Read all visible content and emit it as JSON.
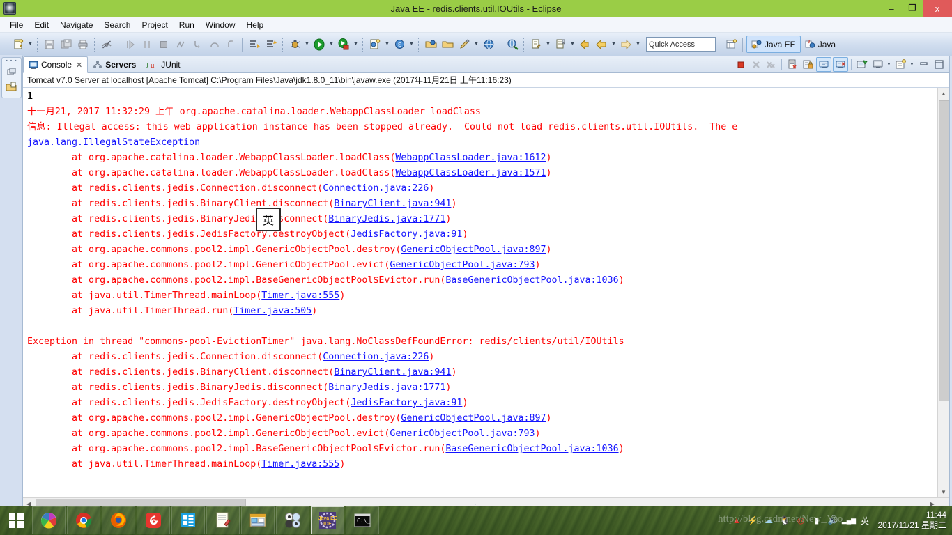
{
  "window": {
    "title": "Java EE - redis.clients.util.IOUtils - Eclipse",
    "app_icon": "eclipse-icon",
    "minimize_label": "–",
    "maximize_label": "❐",
    "close_label": "x",
    "titlebar_color": "#9ACD46"
  },
  "menubar": {
    "items": [
      {
        "label": "File"
      },
      {
        "label": "Edit"
      },
      {
        "label": "Navigate"
      },
      {
        "label": "Search"
      },
      {
        "label": "Project"
      },
      {
        "label": "Run"
      },
      {
        "label": "Window"
      },
      {
        "label": "Help"
      }
    ]
  },
  "toolbar": {
    "quick_access_placeholder": "Quick Access",
    "quick_access_value": "",
    "perspectives": [
      {
        "label": "Java EE",
        "active": true,
        "icon": "javaee-perspective-icon"
      },
      {
        "label": "Java",
        "active": false,
        "icon": "java-perspective-icon"
      }
    ],
    "open_perspective_icon": "open-perspective-icon"
  },
  "left_rail": {
    "restore_icon": "restore-view-icon",
    "project_explorer_icon": "project-explorer-icon"
  },
  "view": {
    "tabs": [
      {
        "label": "Console",
        "icon": "console-icon",
        "active": true,
        "closable": true
      },
      {
        "label": "Servers",
        "icon": "servers-icon",
        "active": false,
        "bold": true
      },
      {
        "label": "JUnit",
        "icon": "junit-icon",
        "active": false
      }
    ],
    "toolbar_buttons": [
      {
        "name": "terminate-button",
        "icon": "stop-square-icon",
        "enabled": true
      },
      {
        "name": "remove-launch-button",
        "icon": "x-icon",
        "enabled": false
      },
      {
        "name": "remove-all-terminated-button",
        "icon": "xx-icon",
        "enabled": false
      },
      {
        "name": "clear-console-button",
        "icon": "clear-console-icon",
        "enabled": true
      },
      {
        "name": "scroll-lock-button",
        "icon": "scroll-lock-icon",
        "enabled": true
      },
      {
        "name": "show-console-on-output-button",
        "icon": "show-on-output-icon",
        "toggled": true
      },
      {
        "name": "show-console-on-error-button",
        "icon": "show-on-error-icon",
        "toggled": true
      },
      {
        "name": "pin-console-button",
        "icon": "pin-console-icon",
        "enabled": true
      },
      {
        "name": "display-selected-console-button",
        "icon": "display-console-icon",
        "enabled": true
      },
      {
        "name": "open-console-button",
        "icon": "open-console-icon",
        "enabled": true
      },
      {
        "name": "minimize-view-button",
        "icon": "minimize-icon",
        "enabled": true
      },
      {
        "name": "maximize-view-button",
        "icon": "maximize-icon",
        "enabled": true
      }
    ],
    "header": "Tomcat v7.0 Server at localhost [Apache Tomcat] C:\\Program Files\\Java\\jdk1.8.0_11\\bin\\javaw.exe (2017年11月21日 上午11:16:23)"
  },
  "console": {
    "ime_indicator": "英",
    "lines": [
      {
        "segments": [
          {
            "text": "1",
            "style": "blk"
          }
        ]
      },
      {
        "segments": [
          {
            "text": "十一月21, 2017 11:32:29 上午 org.apache.catalina.loader.WebappClassLoader loadClass",
            "style": "err"
          }
        ]
      },
      {
        "segments": [
          {
            "text": "信息: Illegal access: this web application instance has been stopped already.  Could not load redis.clients.util.IOUtils.  The e",
            "style": "err"
          }
        ]
      },
      {
        "segments": [
          {
            "text": "java.lang.IllegalStateException",
            "style": "lnk"
          }
        ]
      },
      {
        "segments": [
          {
            "text": "        at org.apache.catalina.loader.WebappClassLoader.loadClass(",
            "style": "err"
          },
          {
            "text": "WebappClassLoader.java:1612",
            "style": "lnk"
          },
          {
            "text": ")",
            "style": "err"
          }
        ]
      },
      {
        "segments": [
          {
            "text": "        at org.apache.catalina.loader.WebappClassLoader.loadClass(",
            "style": "err"
          },
          {
            "text": "WebappClassLoader.java:1571",
            "style": "lnk"
          },
          {
            "text": ")",
            "style": "err"
          }
        ]
      },
      {
        "segments": [
          {
            "text": "        at redis.clients.jedis.Connection.disconnect(",
            "style": "err"
          },
          {
            "text": "Connection.java:226",
            "style": "lnk"
          },
          {
            "text": ")",
            "style": "err"
          }
        ]
      },
      {
        "segments": [
          {
            "text": "        at redis.clients.jedis.BinaryClient.disconnect(",
            "style": "err"
          },
          {
            "text": "BinaryClient.java:941",
            "style": "lnk"
          },
          {
            "text": ")",
            "style": "err"
          }
        ]
      },
      {
        "segments": [
          {
            "text": "        at redis.clients.jedis.BinaryJedis.disconnect(",
            "style": "err"
          },
          {
            "text": "BinaryJedis.java:1771",
            "style": "lnk"
          },
          {
            "text": ")",
            "style": "err"
          }
        ]
      },
      {
        "segments": [
          {
            "text": "        at redis.clients.jedis.JedisFactory.destroyObject(",
            "style": "err"
          },
          {
            "text": "JedisFactory.java:91",
            "style": "lnk"
          },
          {
            "text": ")",
            "style": "err"
          }
        ]
      },
      {
        "segments": [
          {
            "text": "        at org.apache.commons.pool2.impl.GenericObjectPool.destroy(",
            "style": "err"
          },
          {
            "text": "GenericObjectPool.java:897",
            "style": "lnk"
          },
          {
            "text": ")",
            "style": "err"
          }
        ]
      },
      {
        "segments": [
          {
            "text": "        at org.apache.commons.pool2.impl.GenericObjectPool.evict(",
            "style": "err"
          },
          {
            "text": "GenericObjectPool.java:793",
            "style": "lnk"
          },
          {
            "text": ")",
            "style": "err"
          }
        ]
      },
      {
        "segments": [
          {
            "text": "        at org.apache.commons.pool2.impl.BaseGenericObjectPool$Evictor.run(",
            "style": "err"
          },
          {
            "text": "BaseGenericObjectPool.java:1036",
            "style": "lnk"
          },
          {
            "text": ")",
            "style": "err"
          }
        ]
      },
      {
        "segments": [
          {
            "text": "        at java.util.TimerThread.mainLoop(",
            "style": "err"
          },
          {
            "text": "Timer.java:555",
            "style": "lnk"
          },
          {
            "text": ")",
            "style": "err"
          }
        ]
      },
      {
        "segments": [
          {
            "text": "        at java.util.TimerThread.run(",
            "style": "err"
          },
          {
            "text": "Timer.java:505",
            "style": "lnk"
          },
          {
            "text": ")",
            "style": "err"
          }
        ]
      },
      {
        "segments": [
          {
            "text": "",
            "style": "err"
          }
        ]
      },
      {
        "segments": [
          {
            "text": "Exception in thread \"commons-pool-EvictionTimer\" java.lang.NoClassDefFoundError: redis/clients/util/IOUtils",
            "style": "err"
          }
        ]
      },
      {
        "segments": [
          {
            "text": "        at redis.clients.jedis.Connection.disconnect(",
            "style": "err"
          },
          {
            "text": "Connection.java:226",
            "style": "lnk"
          },
          {
            "text": ")",
            "style": "err"
          }
        ]
      },
      {
        "segments": [
          {
            "text": "        at redis.clients.jedis.BinaryClient.disconnect(",
            "style": "err"
          },
          {
            "text": "BinaryClient.java:941",
            "style": "lnk"
          },
          {
            "text": ")",
            "style": "err"
          }
        ]
      },
      {
        "segments": [
          {
            "text": "        at redis.clients.jedis.BinaryJedis.disconnect(",
            "style": "err"
          },
          {
            "text": "BinaryJedis.java:1771",
            "style": "lnk"
          },
          {
            "text": ")",
            "style": "err"
          }
        ]
      },
      {
        "segments": [
          {
            "text": "        at redis.clients.jedis.JedisFactory.destroyObject(",
            "style": "err"
          },
          {
            "text": "JedisFactory.java:91",
            "style": "lnk"
          },
          {
            "text": ")",
            "style": "err"
          }
        ]
      },
      {
        "segments": [
          {
            "text": "        at org.apache.commons.pool2.impl.GenericObjectPool.destroy(",
            "style": "err"
          },
          {
            "text": "GenericObjectPool.java:897",
            "style": "lnk"
          },
          {
            "text": ")",
            "style": "err"
          }
        ]
      },
      {
        "segments": [
          {
            "text": "        at org.apache.commons.pool2.impl.GenericObjectPool.evict(",
            "style": "err"
          },
          {
            "text": "GenericObjectPool.java:793",
            "style": "lnk"
          },
          {
            "text": ")",
            "style": "err"
          }
        ]
      },
      {
        "segments": [
          {
            "text": "        at org.apache.commons.pool2.impl.BaseGenericObjectPool$Evictor.run(",
            "style": "err"
          },
          {
            "text": "BaseGenericObjectPool.java:1036",
            "style": "lnk"
          },
          {
            "text": ")",
            "style": "err"
          }
        ]
      },
      {
        "segments": [
          {
            "text": "        at java.util.TimerThread.mainLoop(",
            "style": "err"
          },
          {
            "text": "Timer.java:555",
            "style": "lnk"
          },
          {
            "text": ")",
            "style": "err"
          }
        ]
      }
    ]
  },
  "taskbar": {
    "start_label": "Start",
    "pinned": [
      {
        "name": "taskbar-item-colorful-pinwheel",
        "active": false
      },
      {
        "name": "taskbar-item-chrome",
        "active": false
      },
      {
        "name": "taskbar-item-firefox",
        "active": false
      },
      {
        "name": "taskbar-item-netease-music",
        "active": false
      },
      {
        "name": "taskbar-item-explorer",
        "active": false
      },
      {
        "name": "taskbar-item-notepad-editor",
        "active": false
      },
      {
        "name": "taskbar-item-file-manager",
        "active": false
      },
      {
        "name": "taskbar-item-anime-player",
        "active": false
      },
      {
        "name": "taskbar-item-eclipse-javaee",
        "active": true
      },
      {
        "name": "taskbar-item-command-prompt",
        "active": false
      }
    ],
    "tray": [
      {
        "name": "tray-icon-triangle",
        "glyph": "▲"
      },
      {
        "name": "tray-icon-thunder",
        "glyph": "⚡"
      },
      {
        "name": "tray-icon-cloud-sync",
        "glyph": "☁"
      },
      {
        "name": "tray-icon-qq",
        "glyph": "🐧"
      },
      {
        "name": "tray-icon-netease-music",
        "glyph": "◎"
      },
      {
        "name": "tray-icon-battery",
        "glyph": "▮"
      },
      {
        "name": "tray-icon-volume",
        "glyph": "🔊"
      },
      {
        "name": "tray-icon-network",
        "glyph": "▂▄▆"
      },
      {
        "name": "tray-icon-ime",
        "glyph": "英"
      }
    ],
    "clock_time": "11:44",
    "clock_date": "2017/11/21 星期二",
    "watermark": "http://blog.csdn.net/New_Yao"
  }
}
